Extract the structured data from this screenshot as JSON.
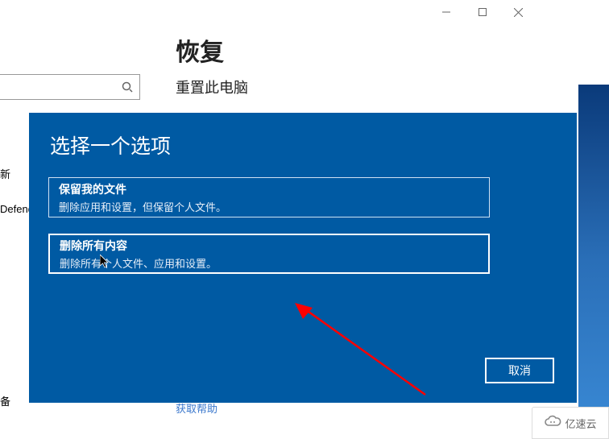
{
  "titlebar": {
    "minimize_tooltip": "最小化",
    "maximize_tooltip": "最大化",
    "close_tooltip": "关闭"
  },
  "page": {
    "heading": "恢复",
    "subheading": "重置此电脑"
  },
  "search": {
    "placeholder": ""
  },
  "sidebar": {
    "item_update_suffix": "新",
    "item_defender": "Defende",
    "item_backup_suffix": "备",
    "item_recovery": ""
  },
  "help_link": "获取帮助",
  "modal": {
    "title": "选择一个选项",
    "options": [
      {
        "title": "保留我的文件",
        "desc": "删除应用和设置，但保留个人文件。"
      },
      {
        "title": "删除所有内容",
        "desc": "删除所有个人文件、应用和设置。"
      }
    ],
    "cancel": "取消"
  },
  "watermark": "亿速云"
}
